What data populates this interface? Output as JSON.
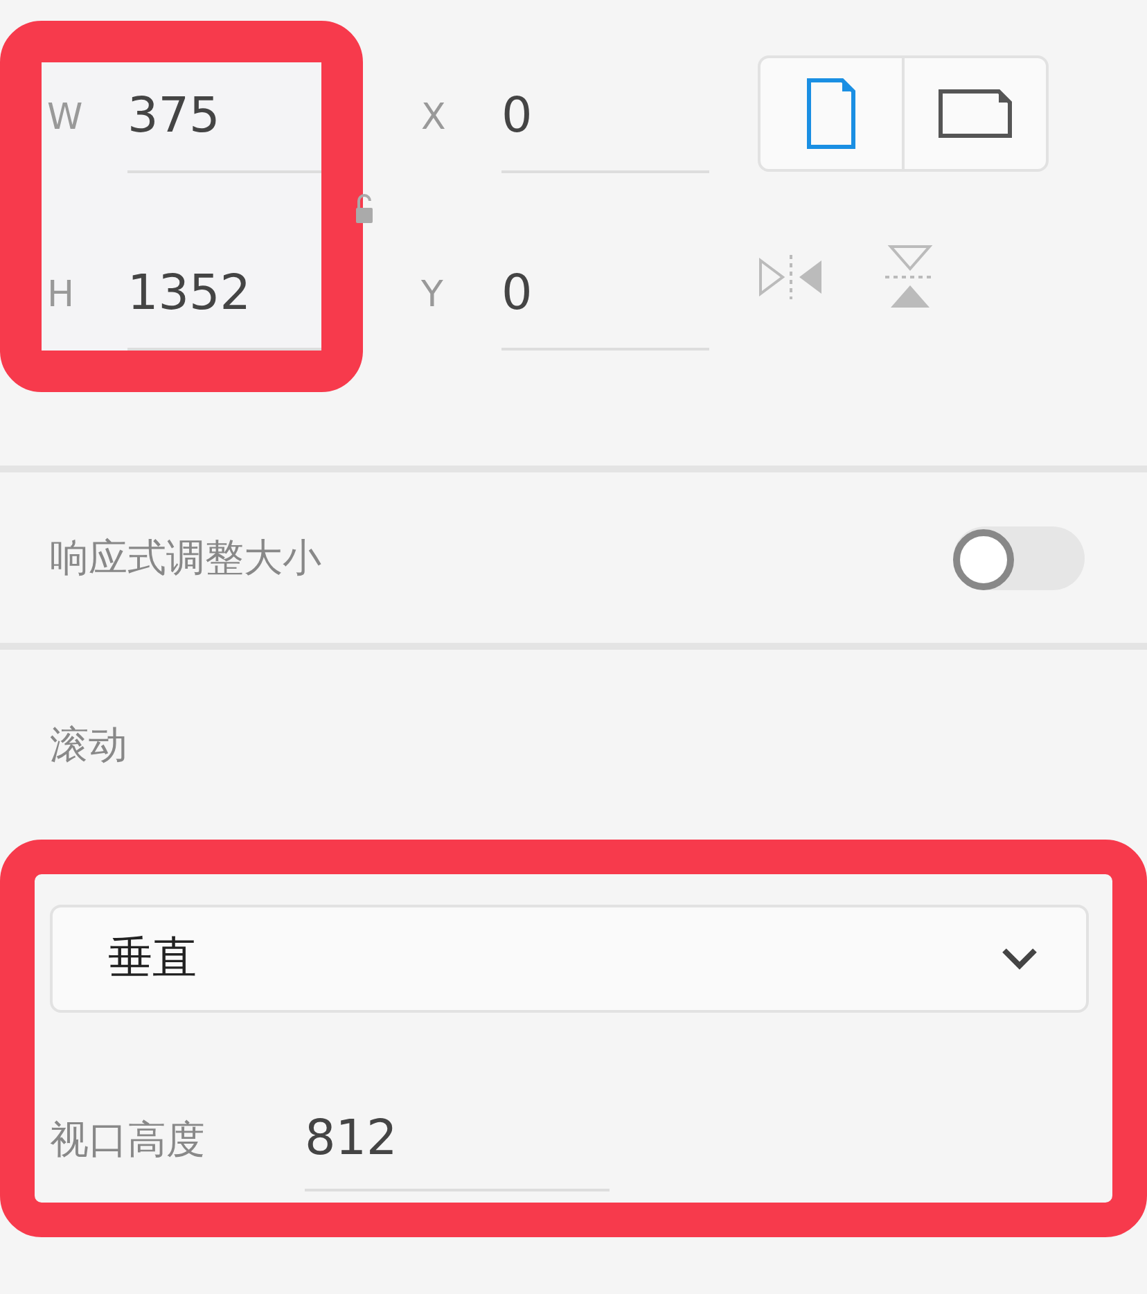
{
  "size": {
    "highlighted": true,
    "fields": [
      {
        "label": "W",
        "value": "375"
      },
      {
        "label": "H",
        "value": "1352"
      }
    ]
  },
  "position": {
    "fields": [
      {
        "label": "X",
        "value": "0"
      },
      {
        "label": "Y",
        "value": "0"
      }
    ]
  },
  "orientation": [
    {
      "kind": "portrait",
      "selected": true
    },
    {
      "kind": "landscape",
      "selected": false
    }
  ],
  "responsive_resize": {
    "label": "响应式调整大小",
    "on": false
  },
  "scrolling": {
    "label": "滚动",
    "highlighted": true,
    "mode": "垂直",
    "viewport_label": "视口高度",
    "viewport_value": "812"
  }
}
